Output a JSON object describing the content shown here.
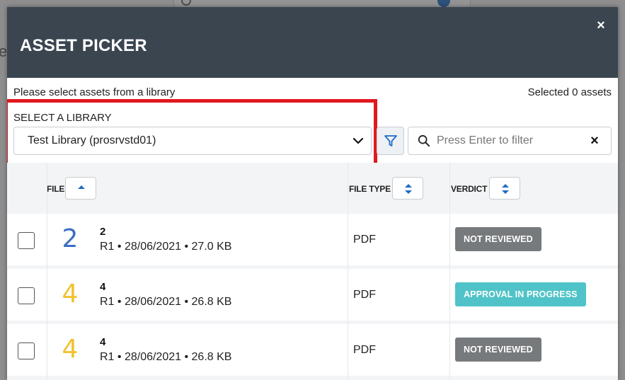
{
  "modal": {
    "title": "ASSET PICKER",
    "close_label": "×"
  },
  "info": {
    "instruction": "Please select assets from a library",
    "selected": "Selected 0 assets"
  },
  "library": {
    "label": "SELECT A LIBRARY",
    "selected": "Test Library (prosrvstd01)"
  },
  "search": {
    "placeholder": "Press Enter to filter",
    "value": "",
    "clear_label": "×"
  },
  "table": {
    "headers": {
      "file": "FILE",
      "file_type": "FILE TYPE",
      "verdict": "VERDICT"
    },
    "rows": [
      {
        "thumb": "2",
        "thumb_color": "#3a6fc4",
        "name": "2",
        "meta": "R1 • 28/06/2021 • 27.0 KB",
        "type": "PDF",
        "verdict": "NOT REVIEWED",
        "verdict_color": "#777a7c"
      },
      {
        "thumb": "4",
        "thumb_color": "#f2c12e",
        "name": "4",
        "meta": "R1 • 28/06/2021 • 26.8 KB",
        "type": "PDF",
        "verdict": "APPROVAL IN PROGRESS",
        "verdict_color": "#4fc3c8"
      },
      {
        "thumb": "4",
        "thumb_color": "#f2c12e",
        "name": "4",
        "meta": "R1 • 28/06/2021 • 26.8 KB",
        "type": "PDF",
        "verdict": "NOT REVIEWED",
        "verdict_color": "#777a7c"
      }
    ]
  },
  "colors": {
    "header_bg": "#3a4550",
    "accent_blue": "#1e6bc6",
    "highlight_red": "#e0191f"
  }
}
